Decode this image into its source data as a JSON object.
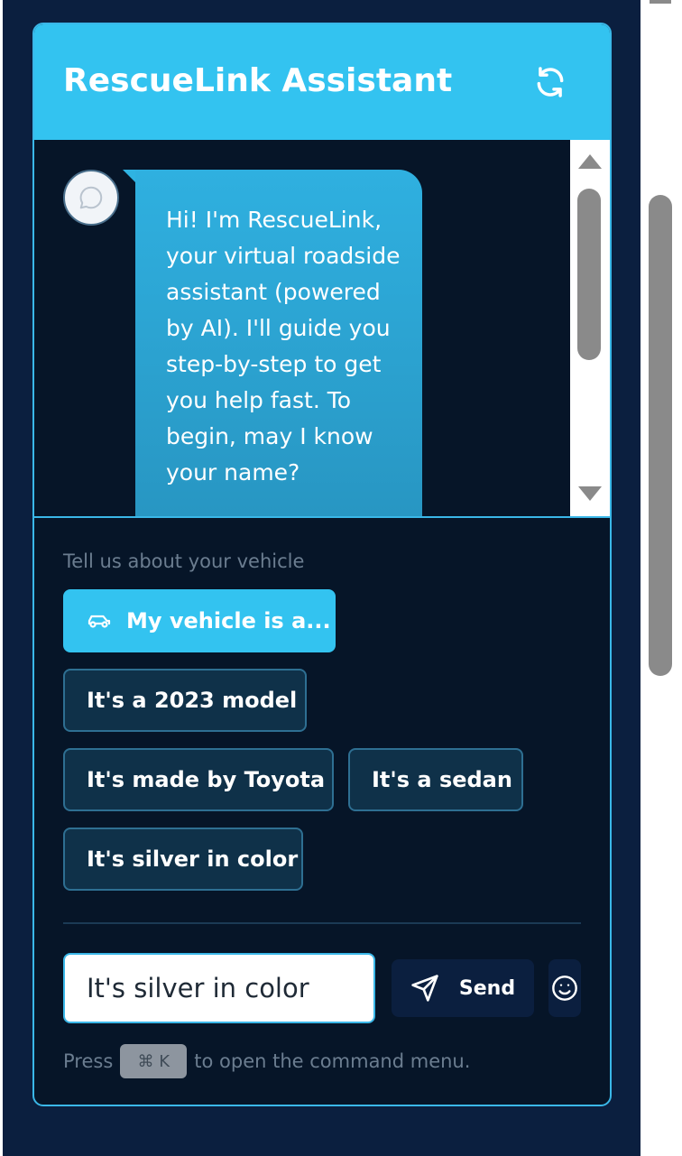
{
  "header": {
    "title": "RescueLink Assistant",
    "refresh_icon": "refresh-icon"
  },
  "chat": {
    "messages": [
      {
        "sender": "assistant",
        "avatar_icon": "chat-bubble-icon",
        "text": "Hi! I'm RescueLink, your virtual roadside assistant (powered by AI). I'll guide you step-by-step to get you help fast. To begin, may I know your name?"
      }
    ]
  },
  "suggestions": {
    "label": "Tell us about your vehicle",
    "primary": {
      "label": "My vehicle is a...",
      "icon": "car-icon"
    },
    "chips": [
      {
        "label": "It's a 2023 model"
      },
      {
        "label": "It's made by Toyota"
      },
      {
        "label": "It's a sedan"
      },
      {
        "label": "It's silver in color"
      }
    ]
  },
  "composer": {
    "input_value": "It's silver in color",
    "send_label": "Send",
    "send_icon": "send-icon",
    "emoji_icon": "smiley-icon"
  },
  "hint": {
    "prefix": "Press",
    "shortcut": "⌘ K",
    "suffix": "to open the command menu."
  },
  "colors": {
    "accent": "#33c3f0",
    "background": "#0b1f3f",
    "panel": "#061528",
    "chip": "#0f3149"
  }
}
